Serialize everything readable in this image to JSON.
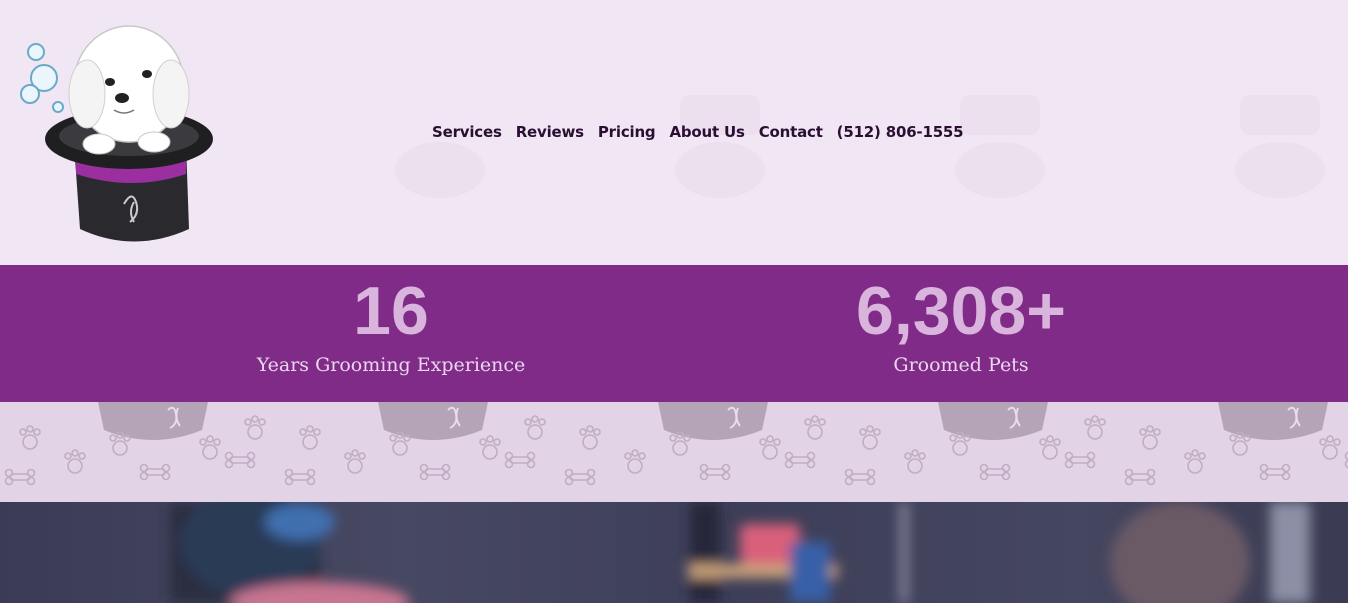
{
  "brand": {
    "logo_icon": "dog-in-top-hat-logo"
  },
  "nav": {
    "items": [
      {
        "label": "Services"
      },
      {
        "label": "Reviews"
      },
      {
        "label": "Pricing"
      },
      {
        "label": "About Us"
      },
      {
        "label": "Contact"
      },
      {
        "label": "(512) 806-1555"
      }
    ]
  },
  "stats": [
    {
      "value": "16",
      "label": "Years Grooming Experience"
    },
    {
      "value": "6,308+",
      "label": "Groomed Pets"
    }
  ],
  "colors": {
    "header_bg": "#f1e6f4",
    "accent_purple": "#812b89",
    "stat_number": "#d9b4dc",
    "nav_text": "#2a0f33",
    "pattern_bg": "#e3d3e6"
  },
  "decor": {
    "pattern_icons": [
      "paw-icon",
      "bone-icon",
      "top-hat-icon"
    ],
    "photo": "blurred-grooming-salon-photo"
  }
}
